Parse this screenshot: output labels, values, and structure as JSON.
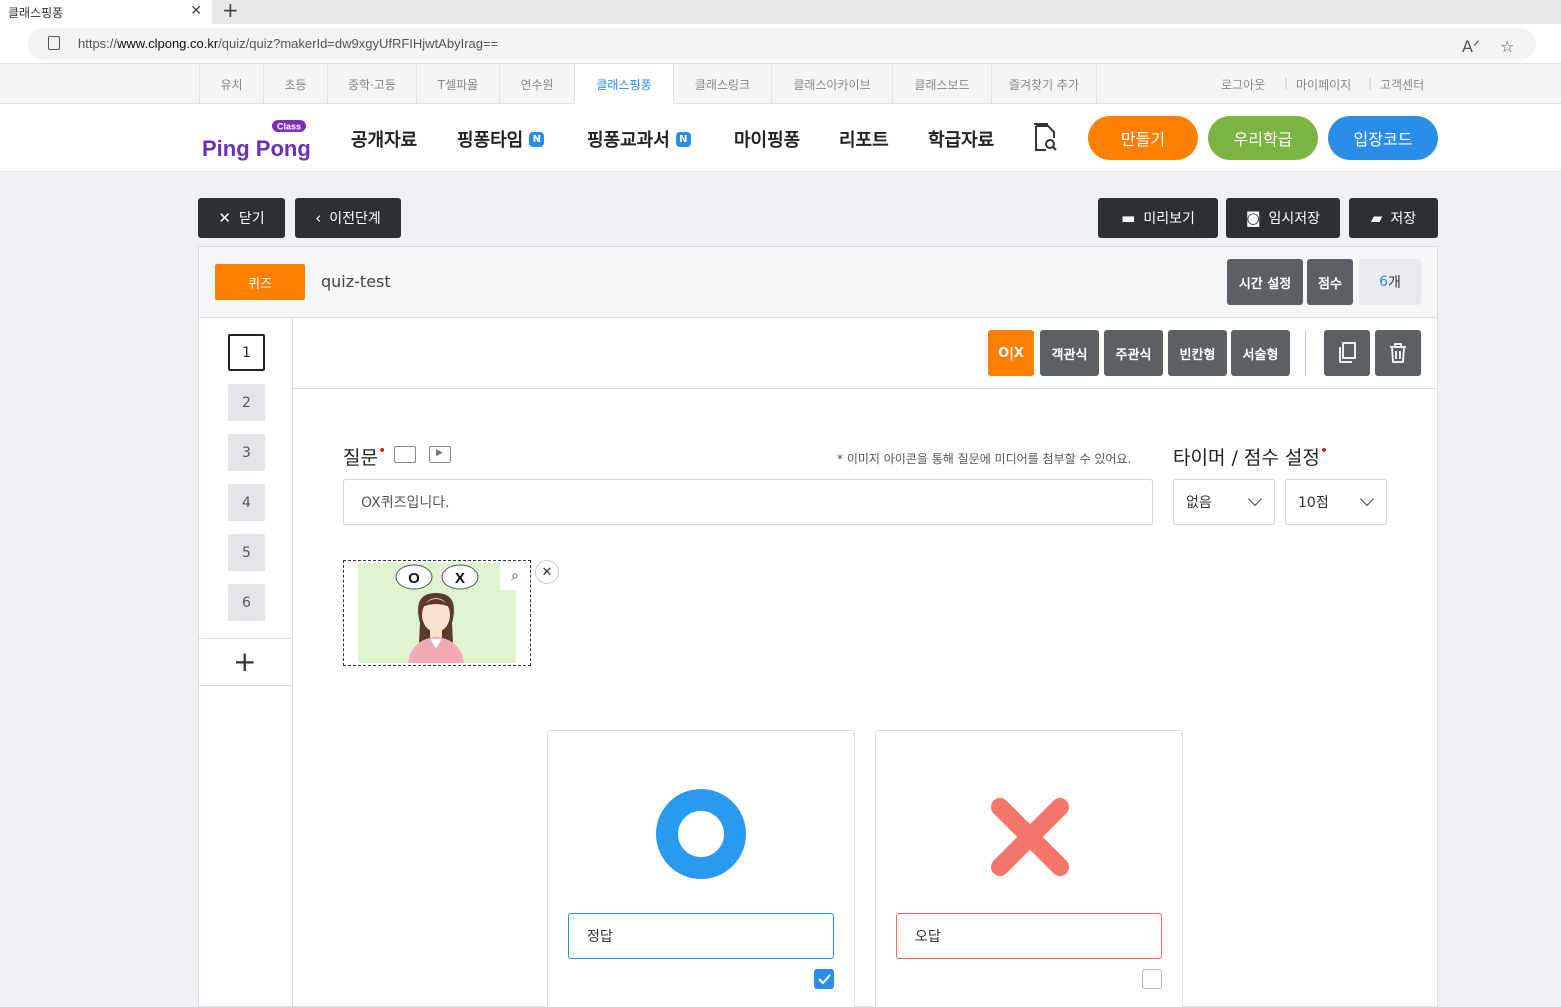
{
  "browser": {
    "tab_title": "클래스핑퐁",
    "url_prefix": "https://",
    "url_domain": "www.clpong.co.kr",
    "url_path": "/quiz/quiz?makerId=dw9xgyUfRFIHjwtAbyIrag=="
  },
  "site_nav": {
    "items": [
      "유치",
      "초등",
      "중학·고등",
      "T셀파몰",
      "연수원",
      "클래스핑퐁",
      "클래스링크",
      "클래스아카이브",
      "클래스보드",
      "즐겨찾기 추가"
    ],
    "active_index": 5,
    "right_links": [
      "로그아웃",
      "마이페이지",
      "고객센터"
    ]
  },
  "header": {
    "logo_text": "Ping Pong",
    "logo_badge": "Class",
    "menu": [
      "공개자료",
      "핑퐁타임",
      "핑퐁교과서",
      "마이핑퐁",
      "리포트",
      "학급자료"
    ],
    "new_badge": "N",
    "pills": [
      {
        "label": "만들기",
        "color": "#ff7f00"
      },
      {
        "label": "우리학급",
        "color": "#7cb342"
      },
      {
        "label": "입장코드",
        "color": "#2a8ee8"
      }
    ]
  },
  "actions": {
    "close": "닫기",
    "prev": "이전단계",
    "preview": "미리보기",
    "temp_save": "임시저장",
    "save": "저장"
  },
  "quiz": {
    "type_badge": "퀴즈",
    "title": "quiz-test",
    "time_setting": "시간 설정",
    "score": "점수",
    "count_num": "6",
    "count_unit": "개",
    "question_numbers": [
      "1",
      "2",
      "3",
      "4",
      "5",
      "6"
    ],
    "active_question": 0,
    "types": [
      "O|X",
      "객관식",
      "주관식",
      "빈칸형",
      "서술형"
    ],
    "question_label": "질문",
    "hint": "* 이미지 아이콘을 통해 질문에 미디어를 첨부할 수 있어요.",
    "question_text": "OX퀴즈입니다.",
    "timer_label": "타이머 / 점수 설정",
    "timer_value": "없음",
    "score_value": "10점",
    "image_bubbles": [
      "O",
      "X"
    ],
    "answers": [
      {
        "label": "정답",
        "checked": true,
        "color": "#2a8ee8"
      },
      {
        "label": "오답",
        "checked": false,
        "color": "#f26b5e"
      }
    ]
  }
}
